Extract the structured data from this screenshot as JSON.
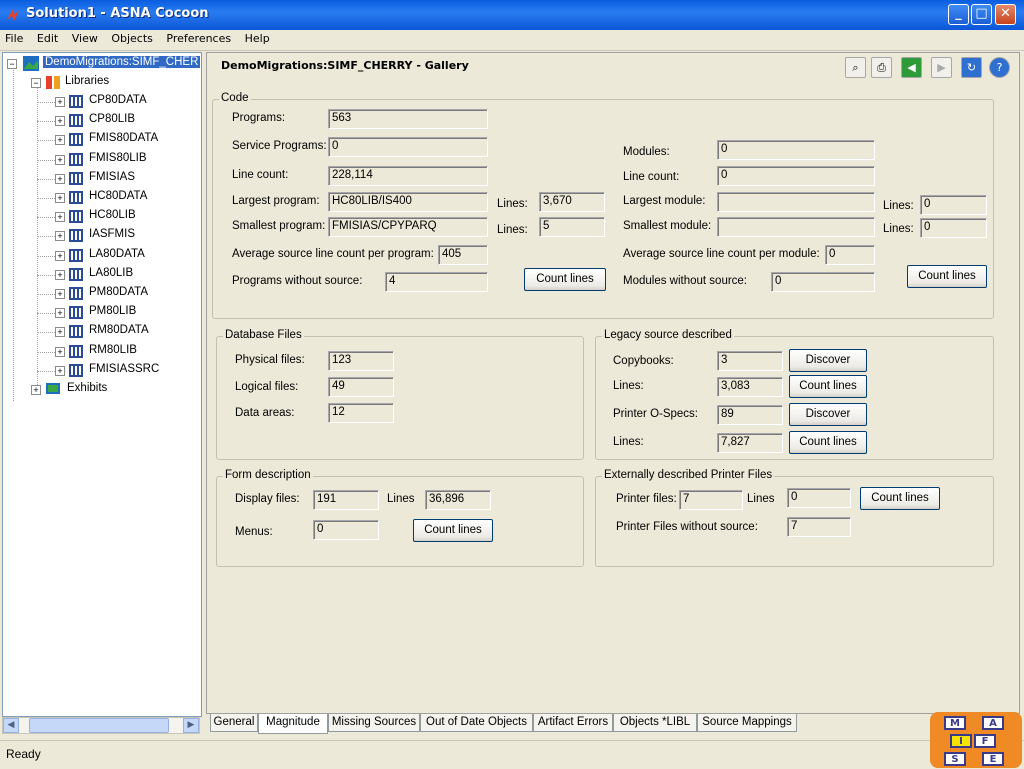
{
  "window": {
    "title": "Solution1 - ASNA Cocoon"
  },
  "menu": [
    "File",
    "Edit",
    "View",
    "Objects",
    "Preferences",
    "Help"
  ],
  "tree": {
    "root": "DemoMigrations:SIMF_CHER",
    "libraries_label": "Libraries",
    "libraries": [
      "CP80DATA",
      "CP80LIB",
      "FMIS80DATA",
      "FMIS80LIB",
      "FMISIAS",
      "HC80DATA",
      "HC80LIB",
      "IASFMIS",
      "LA80DATA",
      "LA80LIB",
      "PM80DATA",
      "PM80LIB",
      "RM80DATA",
      "RM80LIB",
      "FMISIASSRC"
    ],
    "exhibits_label": "Exhibits"
  },
  "gallery": {
    "title": "DemoMigrations:SIMF_CHERRY - Gallery",
    "code": {
      "title": "Code",
      "programs_label": "Programs:",
      "programs": "563",
      "service_programs_label": "Service Programs:",
      "service_programs": "0",
      "line_count_label": "Line count:",
      "line_count": "228,114",
      "largest_program_label": "Largest program:",
      "largest_program": "HC80LIB/IS400",
      "largest_lines_label": "Lines:",
      "largest_lines": "3,670",
      "smallest_program_label": "Smallest program:",
      "smallest_program": "FMISIAS/CPYPARQ",
      "smallest_lines_label": "Lines:",
      "smallest_lines": "5",
      "avg_label": "Average source line count per program:",
      "avg": "405",
      "without_source_label": "Programs without source:",
      "without_source": "4",
      "count_lines": "Count lines",
      "modules_label": "Modules:",
      "modules": "0",
      "mod_line_count_label": "Line count:",
      "mod_line_count": "0",
      "largest_module_label": "Largest module:",
      "largest_module": "",
      "largest_module_lines_label": "Lines:",
      "largest_module_lines": "0",
      "smallest_module_label": "Smallest module:",
      "smallest_module": "",
      "smallest_module_lines_label": "Lines:",
      "smallest_module_lines": "0",
      "mod_avg_label": "Average source line count per module:",
      "mod_avg": "0",
      "mod_without_source_label": "Modules without source:",
      "mod_without_source": "0",
      "mod_count_lines": "Count lines"
    },
    "database": {
      "title": "Database Files",
      "physical_label": "Physical files:",
      "physical": "123",
      "logical_label": "Logical files:",
      "logical": "49",
      "data_areas_label": "Data areas:",
      "data_areas": "12"
    },
    "legacy": {
      "title": "Legacy source described",
      "copybooks_label": "Copybooks:",
      "copybooks": "3",
      "discover1": "Discover",
      "lines1_label": "Lines:",
      "lines1": "3,083",
      "count1": "Count lines",
      "ospecs_label": "Printer O-Specs:",
      "ospecs": "89",
      "discover2": "Discover",
      "lines2_label": "Lines:",
      "lines2": "7,827",
      "count2": "Count lines"
    },
    "form": {
      "title": "Form description",
      "display_label": "Display files:",
      "display": "191",
      "lines_label": "Lines",
      "lines": "36,896",
      "menus_label": "Menus:",
      "menus": "0",
      "count": "Count lines"
    },
    "printer": {
      "title": "Externally described Printer Files",
      "printer_label": "Printer files:",
      "printer": "7",
      "lines_label": "Lines",
      "lines": "0",
      "count": "Count lines",
      "without_label": "Printer Files without source:",
      "without": "7"
    }
  },
  "tabs": [
    "General",
    "Magnitude",
    "Missing Sources",
    "Out of Date Objects",
    "Artifact Errors",
    "Objects *LIBL",
    "Source Mappings"
  ],
  "status": "Ready",
  "logo": [
    "M",
    "A",
    "I",
    "F",
    "S",
    "E"
  ]
}
